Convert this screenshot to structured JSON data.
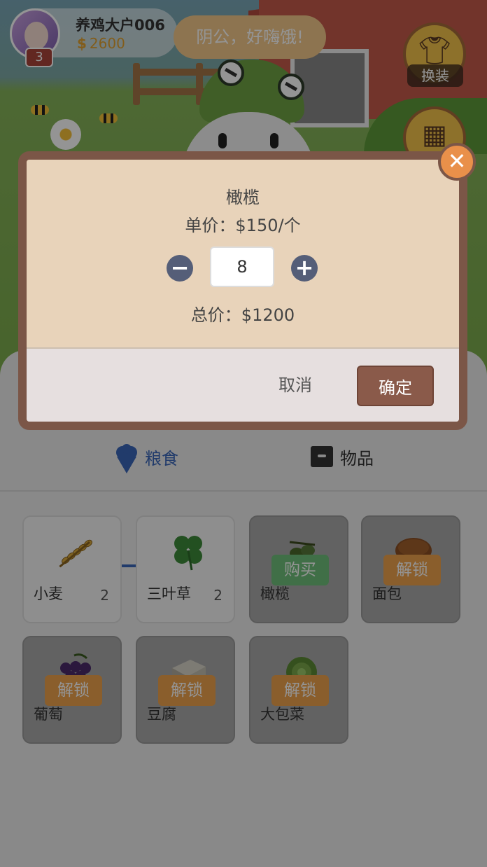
{
  "player": {
    "name": "养鸡大户006",
    "level": "3",
    "currency_symbol": "$",
    "money": "2600"
  },
  "speech_bubble": "阴公，好嗨饿!",
  "side_buttons": {
    "dress_label": "换装"
  },
  "tabs": [
    {
      "label": "粮食",
      "active": true
    },
    {
      "label": "物品",
      "active": false
    }
  ],
  "items": [
    {
      "name": "小麦",
      "count": "2",
      "state": "owned",
      "icon": "wheat-icon"
    },
    {
      "name": "三叶草",
      "count": "2",
      "state": "owned",
      "icon": "clover-icon"
    },
    {
      "name": "橄榄",
      "count": "",
      "state": "buy",
      "tag": "购买",
      "icon": "olive-icon"
    },
    {
      "name": "面包",
      "count": "",
      "state": "locked",
      "tag": "解锁",
      "icon": "bread-icon"
    },
    {
      "name": "葡萄",
      "count": "",
      "state": "locked",
      "tag": "解锁",
      "icon": "grape-icon"
    },
    {
      "name": "豆腐",
      "count": "",
      "state": "locked",
      "tag": "解锁",
      "icon": "tofu-icon"
    },
    {
      "name": "大包菜",
      "count": "",
      "state": "locked",
      "tag": "解锁",
      "icon": "cabbage-icon"
    }
  ],
  "modal": {
    "item_name": "橄榄",
    "unit_price": "单价：$150/个",
    "quantity": "8",
    "total_price": "总价：$1200",
    "cancel_label": "取消",
    "confirm_label": "确定",
    "close_glyph": "✕"
  },
  "colors": {
    "accent_blue": "#3a66b8",
    "modal_border": "#7b5647",
    "confirm": "#8a5a4a",
    "buy_tag": "#6fc07a",
    "unlock_tag": "#eea24d"
  }
}
